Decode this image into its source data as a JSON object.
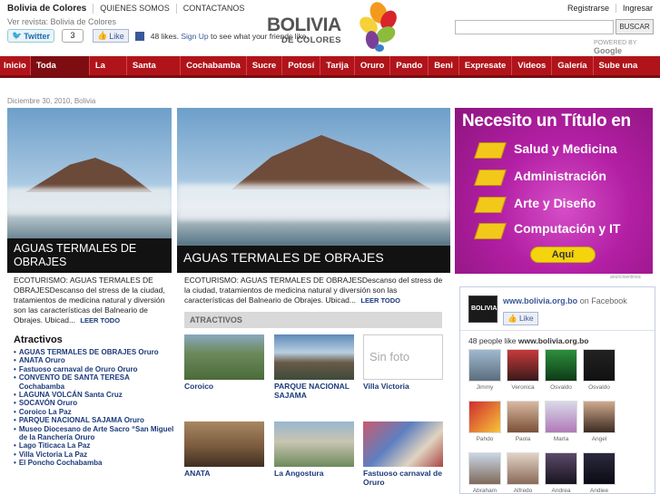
{
  "header": {
    "site_name": "Bolivia de Colores",
    "links": [
      "QUIENES SOMOS",
      "CONTACTANOS"
    ],
    "revista_label": "Ver revista: Bolivia de Colores",
    "tweet_label": "Twitter",
    "tweet_count": "3",
    "like_label": "Like",
    "fb_text": "48 likes.",
    "fb_signup": "Sign Up",
    "fb_text2": "to see what your friends like.",
    "logo_line1": "BOLIVIA",
    "logo_line2": "DE COLORES",
    "register": "Registrarse",
    "login": "Ingresar",
    "search_placeholder": "",
    "search_button": "BUSCAR",
    "powered_by": "POWERED BY",
    "google": "Google"
  },
  "nav": {
    "items": [
      "Inicio",
      "Toda Bolivia",
      "La Paz",
      "Santa Cruz",
      "Cochabamba",
      "Sucre",
      "Potosí",
      "Tarija",
      "Oruro",
      "Pando",
      "Beni",
      "Expresate",
      "Videos",
      "Galería",
      "Sube una Foto"
    ],
    "active": "Toda Bolivia"
  },
  "breadcrumb": "Diciembre 30, 2010, Bolivia",
  "featured_small": {
    "caption": "AGUAS TERMALES DE OBRAJES",
    "excerpt": "ECOTURISMO: AGUAS TERMALES DE OBRAJESDescanso del stress de la ciudad, tratamientos de medicina natural y diversión son las características del Balneario de Obrajes. Ubicad...",
    "more": "LEER TODO"
  },
  "featured_big": {
    "caption": "AGUAS TERMALES DE OBRAJES",
    "excerpt": "ECOTURISMO: AGUAS TERMALES DE OBRAJESDescanso del stress de la ciudad, tratamientos de medicina natural y diversión son las características del Balneario de Obrajes. Ubicad...",
    "more": "LEER TODO"
  },
  "ad": {
    "title": "Necesito un Título en",
    "items": [
      "Salud y Medicina",
      "Administración",
      "Arte y Diseño",
      "Computación y IT"
    ],
    "button": "Aquí",
    "footer": "anuncioenlinea"
  },
  "atractivos": {
    "heading": "ATRACTIVOS",
    "items": [
      "Coroico",
      "PARQUE NACIONAL SAJAMA",
      "Villa Victoria",
      "ANATA",
      "La Angostura",
      "Fastuoso carnaval de Oruro"
    ],
    "no_photo": "Sin foto"
  },
  "sidebar": {
    "heading": "Atractivos",
    "items": [
      [
        "AGUAS TERMALES DE OBRAJES",
        "Oruro"
      ],
      [
        "ANATA",
        "Oruro"
      ],
      [
        "Fastuoso carnaval de Oruro",
        "Oruro"
      ],
      [
        "CONVENTO DE SANTA TERESA",
        "Cochabamba"
      ],
      [
        "LAGUNA VOLCÁN",
        "Santa Cruz"
      ],
      [
        "SOCAVÓN",
        "Oruro"
      ],
      [
        "Coroico",
        "La Paz"
      ],
      [
        "PARQUE NACIONAL SAJAMA",
        "Oruro"
      ],
      [
        "Museo Diocesano de Arte Sacro “San Miguel de la Ranchería",
        "Oruro"
      ],
      [
        "Lago Titicaca",
        "La Paz"
      ],
      [
        "Villa Victoria",
        "La Paz"
      ],
      [
        "El Poncho",
        "Cochabamba"
      ]
    ]
  },
  "facebook": {
    "name": "www.bolivia.org.bo",
    "on": "on Facebook",
    "like": "Like",
    "count_text": "48 people like",
    "count_name": "www.bolivia.org.bo",
    "fans": [
      "Jimmy",
      "Veronica",
      "Osvaldo",
      "Osvaldo",
      "Pahdo",
      "Paola",
      "Marta",
      "Angel",
      "Abraham",
      "Alfredo",
      "Andrea",
      "Andiee"
    ]
  },
  "colors": {
    "nav_red": "#b0141a",
    "nav_active": "#7e0d12",
    "link_blue": "#1b3a7a",
    "ad_magenta": "#b31fa4"
  }
}
